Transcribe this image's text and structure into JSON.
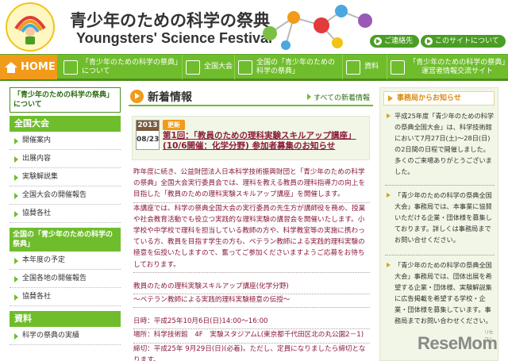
{
  "header": {
    "logo_ring_text": "YOUNGSTERS' SCIENCE FESTIVAL",
    "title_ja": "青少年のための科学の祭典",
    "title_en": "Youngsters' Science Festival",
    "buttons": [
      "ご連絡先",
      "このサイトについて"
    ]
  },
  "nav": {
    "home": "HOME",
    "items": [
      "「青少年のための科学の祭典」について",
      "全国大会",
      "全国の「青少年のための科学の祭典」",
      "資料",
      "「青少年のための科学の祭典」運営者情報交流サイト"
    ]
  },
  "left": {
    "section_about": "「青少年のための科学の祭典」について",
    "section_national": "全国大会",
    "national_links": [
      "開催案内",
      "出展内容",
      "実験解説集",
      "全国大会の開催報告",
      "協賛各社"
    ],
    "section_local": "全国の「青少年のための科学の祭典」",
    "local_links": [
      "本年度の予定",
      "全国各地の開催報告",
      "協賛各社"
    ],
    "section_docs": "資料",
    "docs_links": [
      "科学の祭典の実績"
    ]
  },
  "main": {
    "news_title": "新着情報",
    "news_all": "すべての新着情報",
    "article": {
      "year": "2013",
      "date": "08/23",
      "badge": "更新",
      "title": "第1回：「教員のための理科実験スキルアップ講座」(10/6開催：化学分野) 参加者募集のお知らせ",
      "body_1": "昨年度に続き、公益財団法人日本科学技術振興財団と「青少年のための科学の祭典」全国大会実行委員会では、理科を教える教員の理科指導力の向上を目指した「教員のための理科実験スキルアップ講座」を開催します。",
      "body_2": "本講座では、科学の祭典全国大会の実行委員の先生方が講師役を務め、授業や社会教育活動でも役立つ実践的な理科実験の講習会を開催いたします。小学校や中学校で理科を担当している教師の方や、科学教室等の実施に携わっている方、教員を目指す学生の方も、ベテラン教師による実践的理科実験の極意を伝授いたしますので、奮ってご参加くださいますようご応募をお待ちしております。",
      "course_name": "教員のための理科実験スキルアップ講座(化学分野)",
      "course_sub": "～ベテラン教師による実践的理科実験極意の伝授～",
      "date_line": "日時：平成25年10月6日(日)14:00～16:00",
      "place_line": "場所：科学技術館　4F　実験スタジアムL(東京都千代田区北の丸公園2－1)",
      "deadline_line": "締切：平成25年 9月29日(日)(必着)。ただし、定員になりましたら締切となります。"
    }
  },
  "right": {
    "head": "事務局からお知らせ",
    "notices": [
      "平成25年度「青少年のための科学の祭典全国大会」は、科学技術館において7月27日(土)～28日(日)の2日間の日程で開催しました。多くのご来場ありがとうございました。",
      "「青少年のための科学の祭典全国大会」事務局では、本事業に協賛いただける企業・団体様を募集しております。詳しくは事務局までお問い合せください。",
      "「青少年のための科学の祭典全国大会」事務局では、団体出展を希望する企業・団体様、実験解説集に広告掲載を希望する学校・企業・団体様を募集しています。事務局までお問い合わせください。"
    ]
  },
  "watermark": {
    "text": "ReseMom",
    "sub": "リセマム"
  }
}
